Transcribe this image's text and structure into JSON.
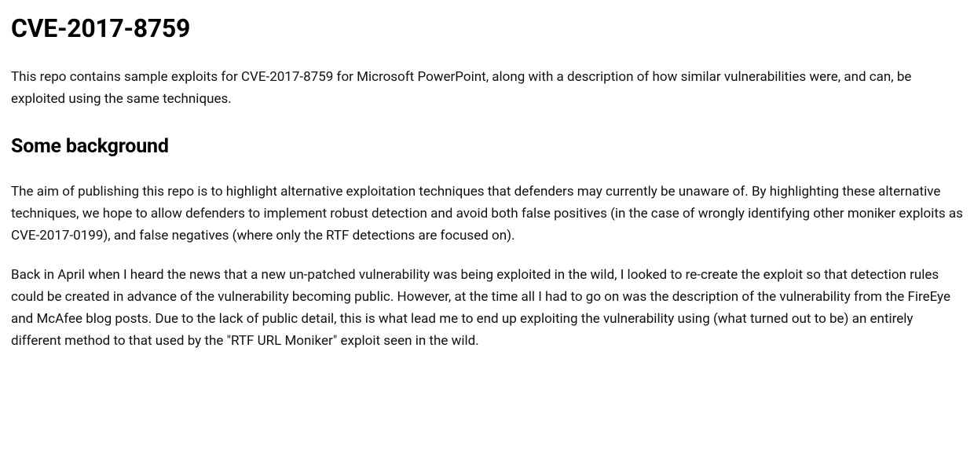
{
  "document": {
    "title": "CVE-2017-8759",
    "intro": "This repo contains sample exploits for CVE-2017-8759 for Microsoft PowerPoint, along with a description of how similar vulnerabilities were, and can, be exploited using the same techniques.",
    "section_heading": "Some background",
    "para1": "The aim of publishing this repo is to highlight alternative exploitation techniques that defenders may currently be unaware of. By highlighting these alternative techniques, we hope to allow defenders to implement robust detection and avoid both false positives (in the case of wrongly identifying other moniker exploits as CVE-2017-0199), and false negatives (where only the RTF detections are focused on).",
    "para2": "Back in April when I heard the news that a new un-patched vulnerability was being exploited in the wild, I looked to re-create the exploit so that detection rules could be created in advance of the vulnerability becoming public. However, at the time all I had to go on was the description of the vulnerability from the FireEye and McAfee blog posts. Due to the lack of public detail, this is what lead me to end up exploiting the vulnerability using (what turned out to be) an entirely different method to that used by the \"RTF URL Moniker\" exploit seen in the wild."
  }
}
